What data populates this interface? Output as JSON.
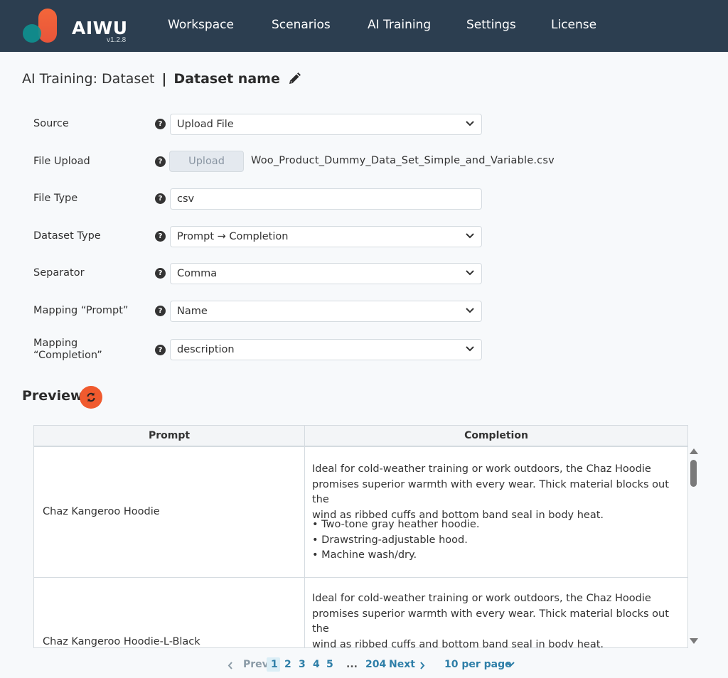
{
  "app": {
    "brand": "AIWU",
    "version": "v1.2.8"
  },
  "nav": {
    "items": [
      "Workspace",
      "Scenarios",
      "AI Training",
      "Settings",
      "License"
    ]
  },
  "page": {
    "title_prefix": "AI Training: Dataset",
    "separator": "|",
    "dataset_name": "Dataset name"
  },
  "form": {
    "help_glyph": "?",
    "source": {
      "label": "Source",
      "value": "Upload File"
    },
    "file_upload": {
      "label": "File Upload",
      "button": "Upload",
      "file_name": "Woo_Product_Dummy_Data_Set_Simple_and_Variable.csv"
    },
    "file_type": {
      "label": "File Type",
      "value": "csv"
    },
    "dataset_type": {
      "label": "Dataset Type",
      "value": "Prompt → Completion"
    },
    "separator": {
      "label": "Separator",
      "value": "Comma"
    },
    "mapping_prompt": {
      "label": "Mapping “Prompt”",
      "value": "Name"
    },
    "mapping_completion": {
      "label_line1": "Mapping",
      "label_line2": "“Completion”",
      "value": "description"
    }
  },
  "preview": {
    "title": "Preview",
    "columns": [
      "Prompt",
      "Completion"
    ],
    "rows": [
      {
        "prompt": "Chaz Kangeroo Hoodie",
        "completion_lines": [
          "Ideal for cold-weather training or work outdoors, the Chaz Hoodie",
          "promises superior warmth with every wear. Thick material blocks out the",
          "wind as ribbed cuffs and bottom band seal in body heat."
        ],
        "bullets": [
          "• Two-tone gray heather hoodie.",
          "• Drawstring-adjustable hood.",
          "• Machine wash/dry."
        ]
      },
      {
        "prompt": "Chaz Kangeroo Hoodie-L-Black",
        "completion_lines": [
          "Ideal for cold-weather training or work outdoors, the Chaz Hoodie",
          "promises superior warmth with every wear. Thick material blocks out the",
          "wind as ribbed cuffs and bottom band seal in body heat."
        ]
      }
    ]
  },
  "pagination": {
    "prev": "Prev",
    "next": "Next",
    "pages": [
      "1",
      "2",
      "3",
      "4",
      "5"
    ],
    "ellipsis": "...",
    "last": "204",
    "current": "1",
    "per_page": "10 per page"
  },
  "colors": {
    "nav_bg": "#2c3e50",
    "accent": "#f05a2e",
    "link": "#2f7fa8"
  }
}
